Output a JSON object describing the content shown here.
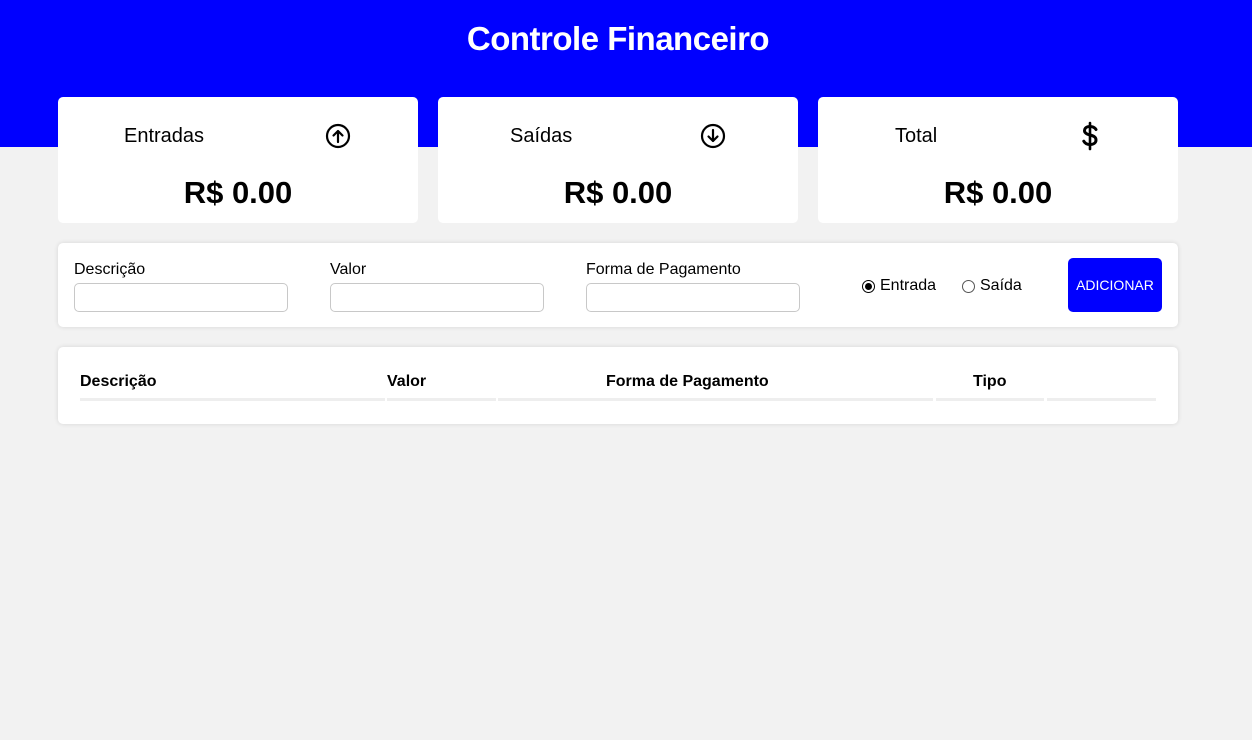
{
  "app": {
    "title": "Controle Financeiro"
  },
  "colors": {
    "primary": "#0000ff",
    "background": "#f2f2f2",
    "card": "#ffffff"
  },
  "cards": [
    {
      "label": "Entradas",
      "icon": "arrow-up-circle-icon",
      "value": "R$ 0.00"
    },
    {
      "label": "Saídas",
      "icon": "arrow-down-circle-icon",
      "value": "R$ 0.00"
    },
    {
      "label": "Total",
      "icon": "dollar-sign-icon",
      "value": "R$ 0.00"
    }
  ],
  "form": {
    "description_label": "Descrição",
    "description_value": "",
    "value_label": "Valor",
    "value_value": "",
    "payment_label": "Forma de Pagamento",
    "payment_value": "",
    "radio_income_label": "Entrada",
    "radio_expense_label": "Saída",
    "selected_type": "Entrada",
    "add_button_label": "ADICIONAR"
  },
  "table": {
    "headers": [
      "Descrição",
      "Valor",
      "Forma de Pagamento",
      "Tipo",
      ""
    ],
    "rows": []
  }
}
